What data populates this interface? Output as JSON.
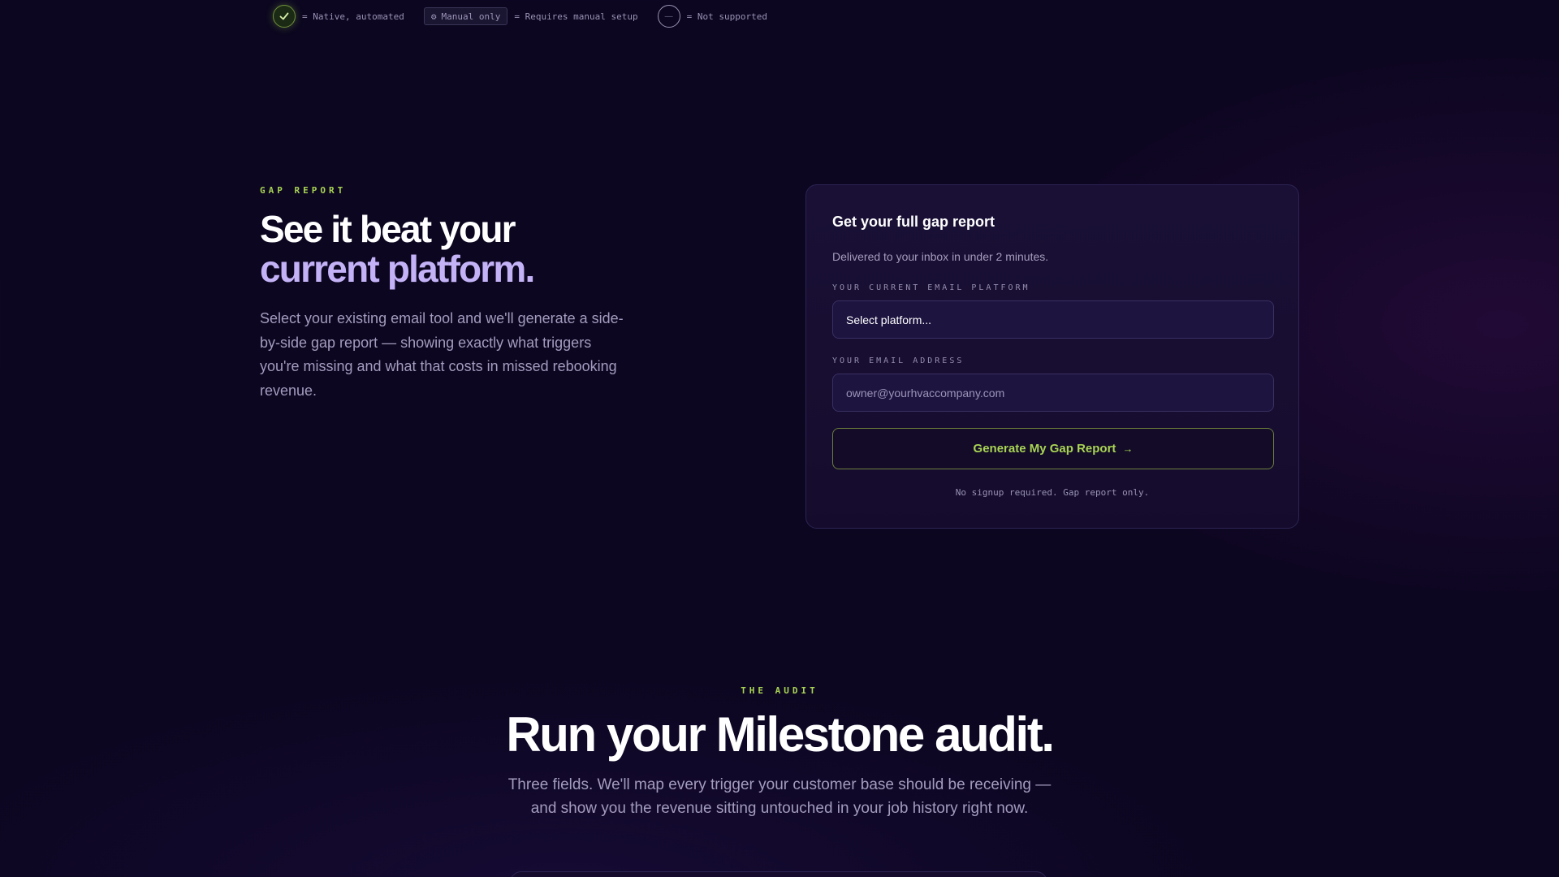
{
  "legend": {
    "native_label": "= Native, automated",
    "manual_badge": "Manual only",
    "manual_label": "= Requires manual setup",
    "none_glyph": "—",
    "none_label": "= Not supported"
  },
  "gap_report": {
    "eyebrow": "GAP REPORT",
    "title_line1": "See it beat your",
    "title_line2": "current platform.",
    "description": "Select your existing email tool and we'll generate a side-by-side gap report — showing exactly what triggers you're missing and what that costs in missed rebooking revenue."
  },
  "form": {
    "title": "Get your full gap report",
    "subtitle": "Delivered to your inbox in under 2 minutes.",
    "platform_label": "YOUR CURRENT EMAIL PLATFORM",
    "platform_value": "Select platform...",
    "email_label": "YOUR EMAIL ADDRESS",
    "email_placeholder": "owner@yourhvaccompany.com",
    "submit_label": "Generate My Gap Report",
    "submit_arrow": "→",
    "note": "No signup required. Gap report only."
  },
  "audit": {
    "eyebrow": "THE AUDIT",
    "title": "Run your Milestone audit.",
    "description": "Three fields. We'll map every trigger your customer base should be receiving — and show you the revenue sitting untouched in your job history right now."
  },
  "colors": {
    "background": "#0c0620",
    "accent_green": "#a9d454",
    "accent_purple": "#c4b2f7",
    "card": "#1a1036"
  }
}
